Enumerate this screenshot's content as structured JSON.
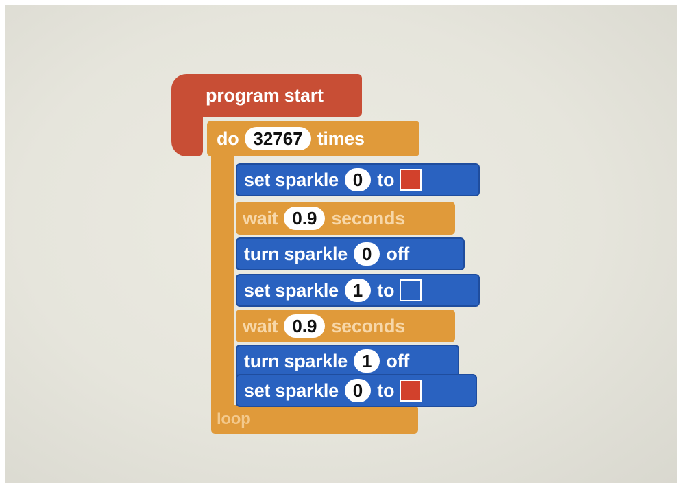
{
  "program": {
    "start_label": "program start",
    "repeat": {
      "prefix": "do",
      "count": "32767",
      "suffix": "times"
    },
    "loop_label": "loop",
    "statements": [
      {
        "type": "set",
        "label": "set sparkle",
        "value": "0",
        "suffix": "to",
        "color": "#d2412c"
      },
      {
        "type": "wait",
        "label": "wait",
        "value": "0.9",
        "suffix": "seconds"
      },
      {
        "type": "turn",
        "label": "turn sparkle",
        "value": "0",
        "suffix": "off"
      },
      {
        "type": "set",
        "label": "set sparkle",
        "value": "1",
        "suffix": "to",
        "color": "#2a62c0"
      },
      {
        "type": "wait",
        "label": "wait",
        "value": "0.9",
        "suffix": "seconds"
      },
      {
        "type": "turn",
        "label": "turn sparkle",
        "value": "1",
        "suffix": "off"
      },
      {
        "type": "set",
        "label": "set sparkle",
        "value": "0",
        "suffix": "to",
        "color": "#d2412c"
      }
    ]
  },
  "colors": {
    "hat_block": "#c84e35",
    "control_block": "#e09a3a",
    "sparkle_block": "#2a62c0",
    "canvas": "#e6e5dc"
  }
}
